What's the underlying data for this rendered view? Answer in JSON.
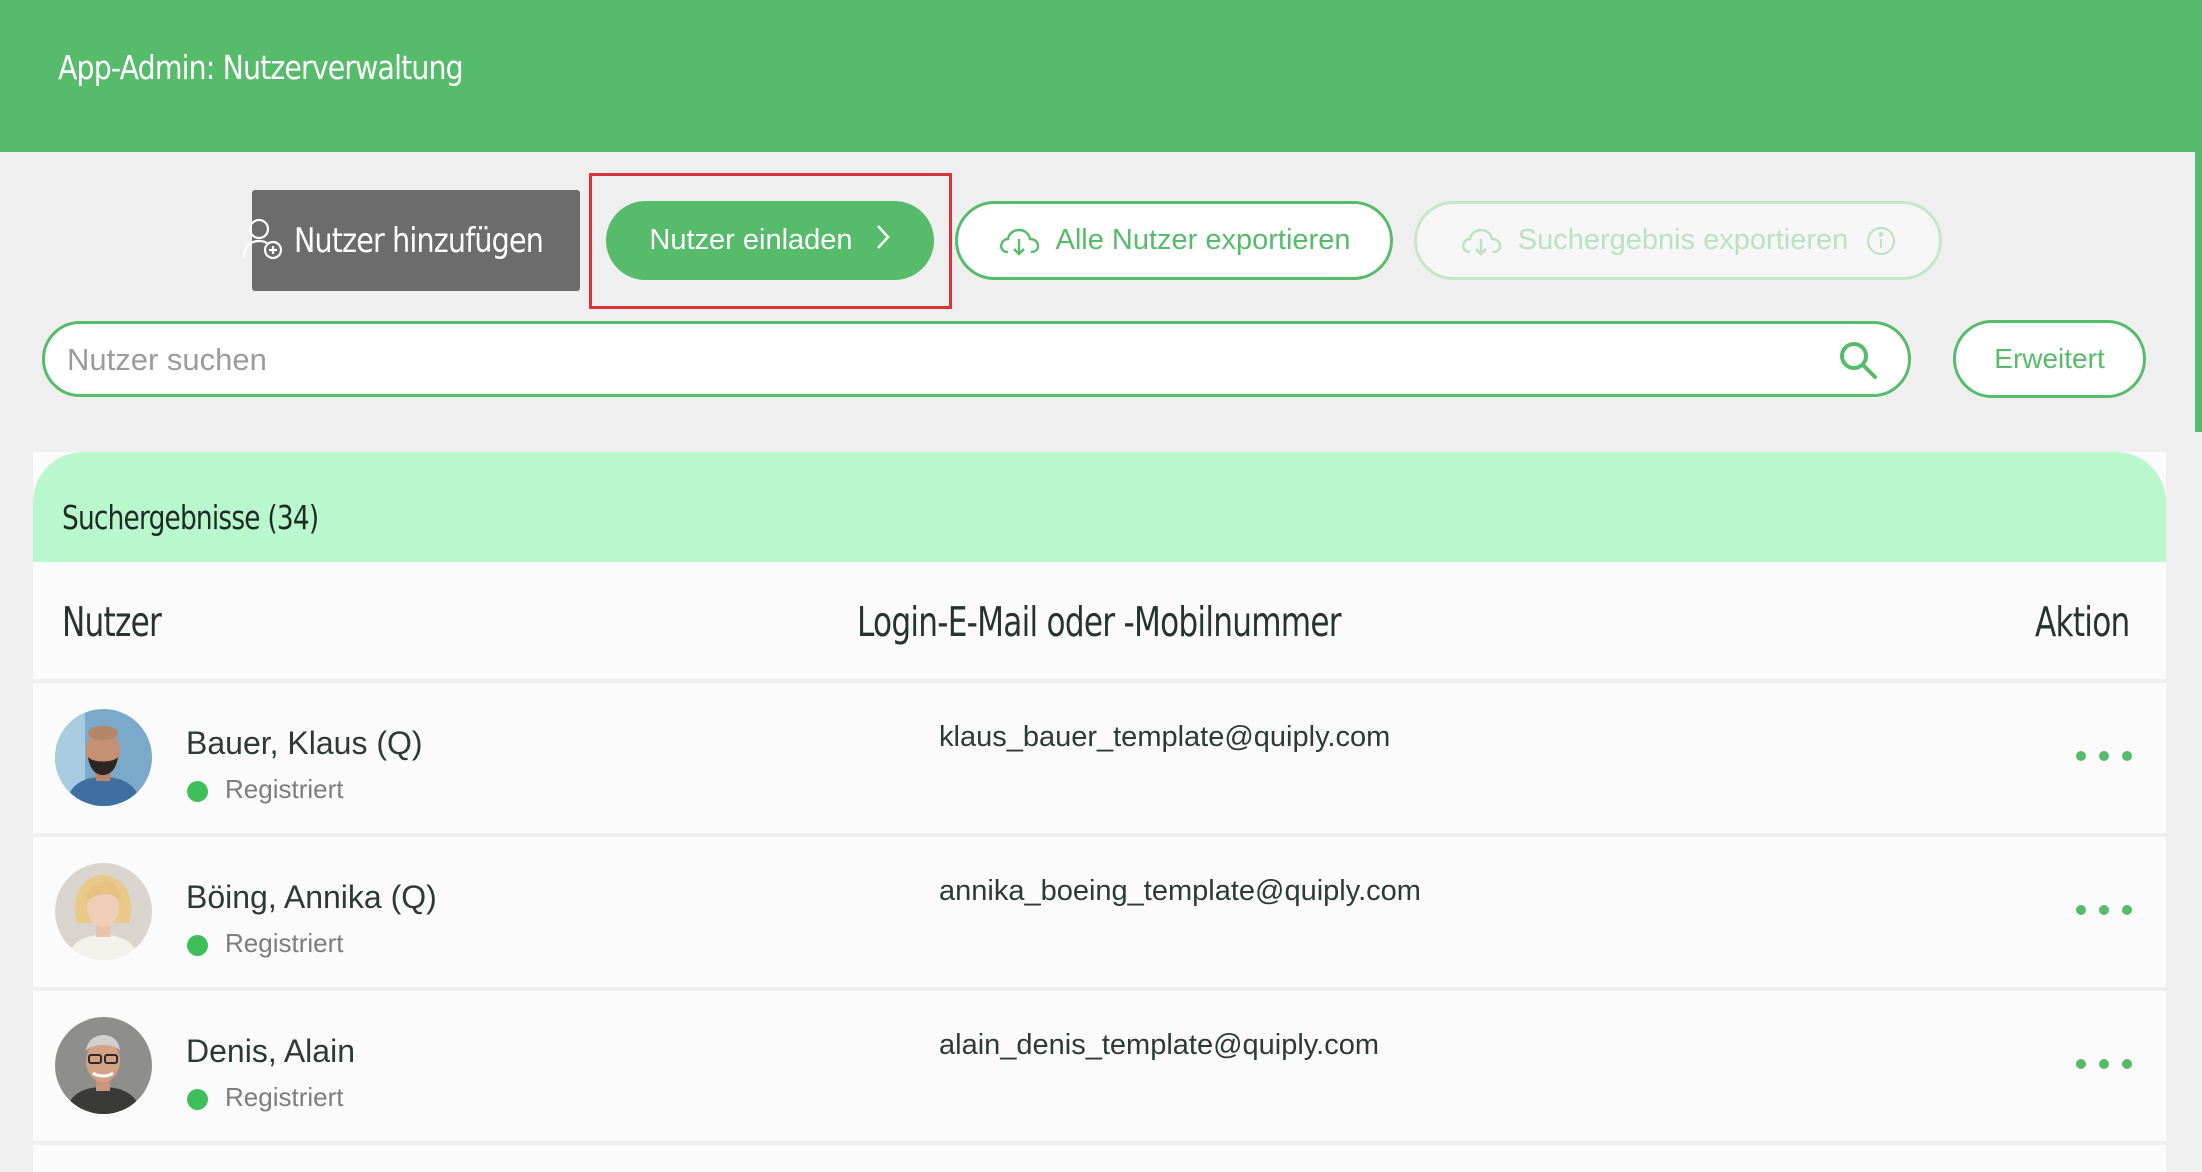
{
  "header": {
    "title": "App-Admin: Nutzerverwaltung"
  },
  "toolbar": {
    "add_user": "Nutzer hinzufügen",
    "invite_user": "Nutzer einladen",
    "export_all": "Alle Nutzer exportieren",
    "export_result": "Suchergebnis exportieren"
  },
  "search": {
    "placeholder": "Nutzer suchen",
    "value": "",
    "advanced": "Erweitert"
  },
  "results": {
    "title": "Suchergebnisse (34)",
    "columns": {
      "user": "Nutzer",
      "login": "Login-E-Mail oder -Mobilnummer",
      "action": "Aktion"
    },
    "rows": [
      {
        "name": "Bauer, Klaus (Q)",
        "status": "Registriert",
        "email": "klaus_bauer_template@quiply.com"
      },
      {
        "name": "Böing, Annika (Q)",
        "status": "Registriert",
        "email": "annika_boeing_template@quiply.com"
      },
      {
        "name": "Denis, Alain",
        "status": "Registriert",
        "email": "alain_denis_template@quiply.com"
      }
    ]
  },
  "colors": {
    "primary": "#56bb6a",
    "header_card": "#b9f8cd",
    "highlight": "#d8343a",
    "button_dark": "#6c6c6c"
  },
  "icons": [
    "add-user-icon",
    "chevron-right-icon",
    "cloud-download-icon",
    "info-icon",
    "search-icon",
    "more-icon"
  ]
}
